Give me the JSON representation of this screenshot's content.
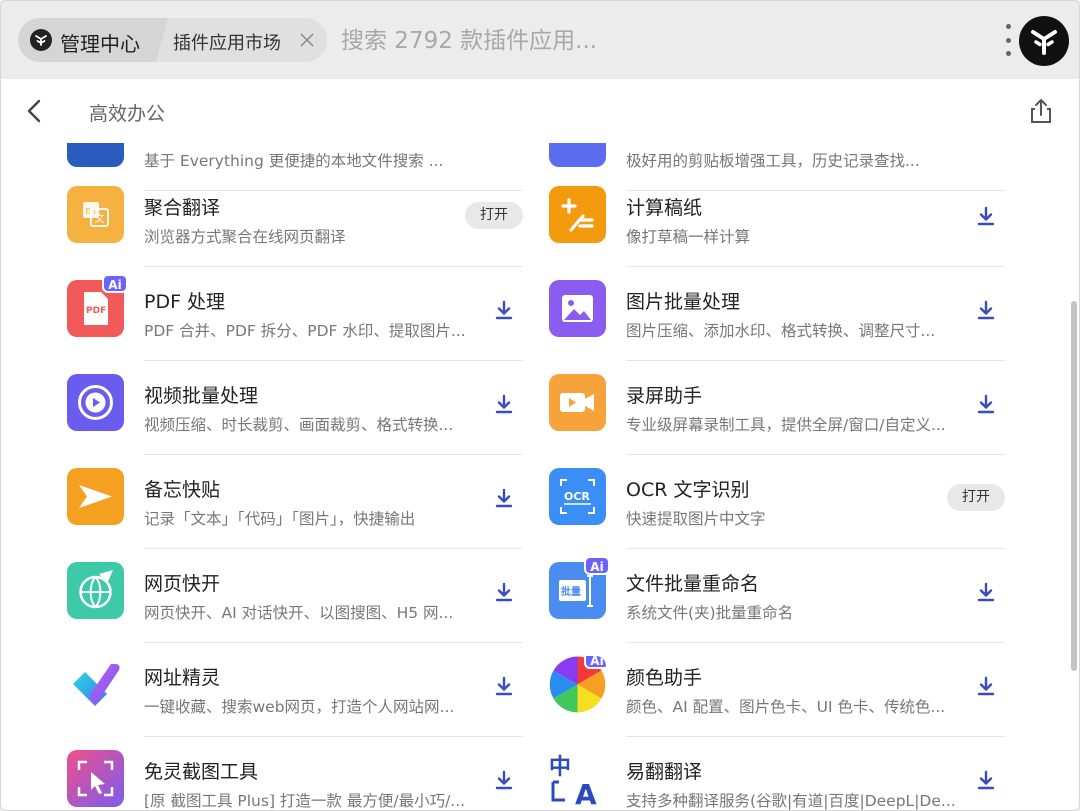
{
  "topbar": {
    "home_label": "管理中心",
    "tab_label": "插件应用市场",
    "search_placeholder": "搜索 2792 款插件应用..."
  },
  "subheader": {
    "title": "高效办公"
  },
  "download_label": "下载",
  "open_label": "打开",
  "partial_row": {
    "left_desc": "基于 Everything 更便捷的本地文件搜索 ...",
    "right_desc": "极好用的剪贴板增强工具，历史记录查找..."
  },
  "apps": [
    {
      "name": "聚合翻译",
      "desc": "浏览器方式聚合在线网页翻译",
      "action": "open",
      "icon": "translate-icon",
      "color": "#f5b240",
      "ai": false
    },
    {
      "name": "计算稿纸",
      "desc": "像打草稿一样计算",
      "action": "download",
      "icon": "calculator-icon",
      "color": "#f39a0f",
      "ai": false
    },
    {
      "name": "PDF 处理",
      "desc": "PDF 合并、PDF 拆分、PDF 水印、提取图片...",
      "action": "download",
      "icon": "pdf-icon",
      "color": "#f25a5a",
      "ai": true
    },
    {
      "name": "图片批量处理",
      "desc": "图片压缩、添加水印、格式转换、调整尺寸...",
      "action": "download",
      "icon": "image-icon",
      "color": "#8a5cf0",
      "ai": false
    },
    {
      "name": "视频批量处理",
      "desc": "视频压缩、时长裁剪、画面裁剪、格式转换...",
      "action": "download",
      "icon": "video-icon",
      "color": "#6b5cf0",
      "ai": false
    },
    {
      "name": "录屏助手",
      "desc": "专业级屏幕录制工具，提供全屏/窗口/自定义...",
      "action": "download",
      "icon": "camera-icon",
      "color": "#f5a33a",
      "ai": false
    },
    {
      "name": "备忘快贴",
      "desc": "记录「文本」「代码」「图片」，快捷输出",
      "action": "download",
      "icon": "star-icon",
      "color": "#f5a020",
      "ai": false
    },
    {
      "name": "OCR 文字识别",
      "desc": "快速提取图片中文字",
      "action": "open",
      "icon": "ocr-icon",
      "color": "#3b8ef5",
      "ai": false
    },
    {
      "name": "网页快开",
      "desc": "网页快开、AI 对话快开、以图搜图、H5 网...",
      "action": "download",
      "icon": "globe-icon",
      "color": "#3ec9a8",
      "ai": false
    },
    {
      "name": "文件批量重命名",
      "desc": "系统文件(夹)批量重命名",
      "action": "download",
      "icon": "rename-icon",
      "color": "#4a8cf0",
      "ai": true
    },
    {
      "name": "网址精灵",
      "desc": "一键收藏、搜索web网页，打造个人网站网...",
      "action": "download",
      "icon": "link-icon",
      "color": "#ffffff",
      "ai": false
    },
    {
      "name": "颜色助手",
      "desc": "颜色、AI 配置、图片色卡、UI 色卡、传统色...",
      "action": "download",
      "icon": "color-wheel-icon",
      "color": "#ffffff",
      "ai": true
    },
    {
      "name": "免灵截图工具",
      "desc": "[原 截图工具 Plus] 打造一款 最方便/最小巧/...",
      "action": "download",
      "icon": "screenshot-icon",
      "color": "#e84a8a",
      "ai": false
    },
    {
      "name": "易翻翻译",
      "desc": "支持多种翻译服务(谷歌|有道|百度|DeepL|De...",
      "action": "download",
      "icon": "translate-ca-icon",
      "color": "#ffffff",
      "ai": false
    }
  ]
}
